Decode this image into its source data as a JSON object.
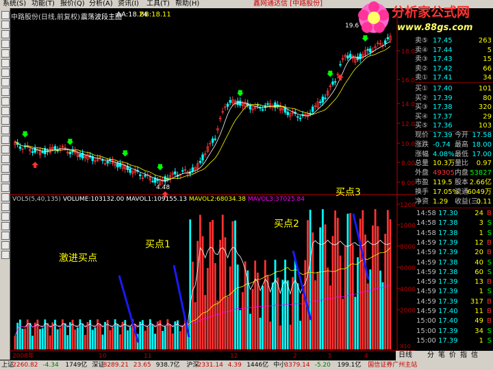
{
  "menu": [
    "系统(S)",
    "功能(T)",
    "报价(Q)",
    "分析(A)",
    "资讯(I)",
    "工具(T)",
    "帮助(H)"
  ],
  "title": {
    "stock": "中路股份(日线,前复权)",
    "indicator": "震荡波段主图",
    "aa": "AA:18.24",
    "bb": "BB:18.11"
  },
  "broker": "鑫网通达信 [中路股份]",
  "logo": {
    "name": "分析家公式网",
    "url": "www.88gs.com"
  },
  "main_chart": {
    "high_label": "19.6",
    "low_label": "4.48",
    "y_ticks": [
      "18.00",
      "16.00",
      "14.00",
      "12.00",
      "10.00",
      "8.00",
      "6.00"
    ]
  },
  "volume_chart": {
    "indicator": "VOL5(5,40,135)",
    "volume": "VOLUME:103132.00",
    "mavol1": "MAVOL1:109155.13",
    "mavol2": "MAVOL2:68034.38",
    "mavol3": "MAVOL3:37025.84",
    "y_ticks": [
      "12000",
      "10000",
      "8000",
      "6000",
      "4000",
      "2000"
    ],
    "unit": "X10",
    "x_labels": [
      "2008年",
      "10",
      "11",
      "12",
      "2",
      "3",
      "4"
    ]
  },
  "annotations": {
    "aggressive": "激进买点",
    "buy1": "买点1",
    "buy2": "买点2",
    "buy3": "买点3"
  },
  "order_book": {
    "sells": [
      {
        "label": "卖⑤",
        "price": "17.45",
        "vol": "263"
      },
      {
        "label": "卖④",
        "price": "17.44",
        "vol": "5"
      },
      {
        "label": "卖③",
        "price": "17.43",
        "vol": "15"
      },
      {
        "label": "卖②",
        "price": "17.42",
        "vol": "66"
      },
      {
        "label": "卖①",
        "price": "17.41",
        "vol": "34"
      }
    ],
    "buys": [
      {
        "label": "买①",
        "price": "17.40",
        "vol": "101"
      },
      {
        "label": "买②",
        "price": "17.39",
        "vol": "80"
      },
      {
        "label": "买③",
        "price": "17.38",
        "vol": "320"
      },
      {
        "label": "买④",
        "price": "17.37",
        "vol": "29"
      },
      {
        "label": "买⑤",
        "price": "17.36",
        "vol": "103"
      }
    ]
  },
  "stats": [
    {
      "k1": "现价",
      "v1": "17.39",
      "k2": "今开",
      "v2": "17.58"
    },
    {
      "k1": "涨跌",
      "v1": "-0.74",
      "k2": "最高",
      "v2": "18.00"
    },
    {
      "k1": "涨幅",
      "v1": "4.08%",
      "k2": "最低",
      "v2": "17.00"
    },
    {
      "k1": "总量",
      "v1": "10.3万",
      "k2": "量比",
      "v2": "0.97"
    },
    {
      "k1": "外盘",
      "v1": "49305",
      "k2": "内盘",
      "v2": "53827"
    },
    {
      "k1": "市盈",
      "v1": "119.5",
      "k2": "股本",
      "v2": "2.66亿"
    },
    {
      "k1": "换手",
      "v1": "17.05%",
      "k2": "流通",
      "v2": "6049万"
    },
    {
      "k1": "净资",
      "v1": "1.29",
      "k2": "收益(三)",
      "v2": "0.11"
    }
  ],
  "ticks": [
    {
      "t": "14:58",
      "p": "17.30",
      "v": "24",
      "s": "B"
    },
    {
      "t": "14:58",
      "p": "17.38",
      "v": "3",
      "s": "S"
    },
    {
      "t": "14:58",
      "p": "17.38",
      "v": "1",
      "s": "S"
    },
    {
      "t": "14:59",
      "p": "17.39",
      "v": "12",
      "s": "B"
    },
    {
      "t": "14:59",
      "p": "17.39",
      "v": "20",
      "s": "B"
    },
    {
      "t": "14:59",
      "p": "17.38",
      "v": "40",
      "s": "S"
    },
    {
      "t": "14:59",
      "p": "17.38",
      "v": "60",
      "s": "S"
    },
    {
      "t": "14:59",
      "p": "17.39",
      "v": "13",
      "s": "B"
    },
    {
      "t": "14:59",
      "p": "17.39",
      "v": "1",
      "s": "S"
    },
    {
      "t": "14:59",
      "p": "17.39",
      "v": "317",
      "s": "B"
    },
    {
      "t": "14:59",
      "p": "17.40",
      "v": "11",
      "s": "B"
    },
    {
      "t": "15:00",
      "p": "17.40",
      "v": "49",
      "s": "B"
    },
    {
      "t": "15:00",
      "p": "17.39",
      "v": "34",
      "s": "S"
    },
    {
      "t": "15:00",
      "p": "17.39",
      "v": "1",
      "s": "S"
    }
  ],
  "tabs": [
    "日线",
    "分",
    "笔",
    "价",
    "指",
    "信"
  ],
  "status": [
    {
      "label": "上证",
      "value": "2260.82",
      "chg": "-4.34",
      "amt": "1749亿"
    },
    {
      "label": "深证",
      "value": "8289.21",
      "chg": "23.65",
      "amt": "938.7亿"
    },
    {
      "label": "沪深",
      "value": "2331.14",
      "chg": "4.39",
      "amt": "1446亿"
    },
    {
      "label": "中小",
      "value": "3379.14",
      "chg": "-5.20",
      "amt": "199.1亿"
    },
    {
      "label": "",
      "value": "国信证券广州主站",
      "chg": "",
      "amt": ""
    }
  ],
  "colors": {
    "up": "#ff3232",
    "down": "#00ffff",
    "ma1": "#ffffff",
    "ma2": "#ffff00",
    "ma3": "#ff00ff",
    "axis": "#c00000"
  }
}
